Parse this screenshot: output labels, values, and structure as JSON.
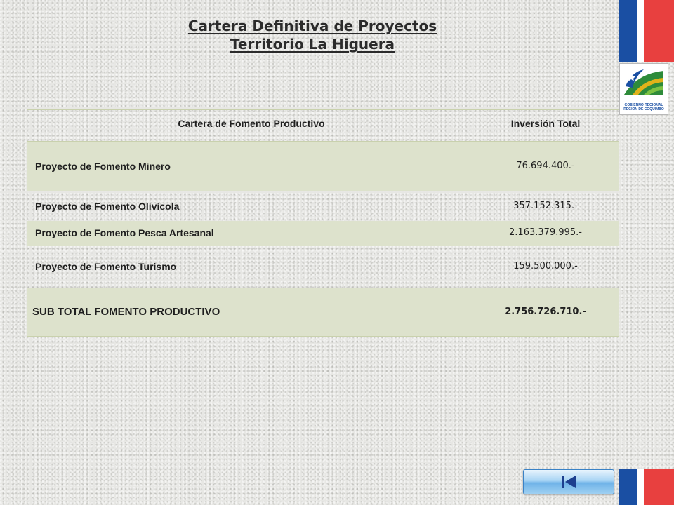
{
  "header": {
    "title_line1": "Cartera Definitiva de Proyectos",
    "title_line2": "Territorio La Higuera"
  },
  "logo": {
    "icon": "gobierno-regional-logo",
    "text_line1": "GOBIERNO REGIONAL",
    "text_line2": "REGION DE COQUIMBO"
  },
  "flag_colors": {
    "blue": "#1a4fa3",
    "white": "#ffffff",
    "red": "#e8403f"
  },
  "table": {
    "headers": [
      "Cartera de Fomento Productivo",
      "Inversión Total"
    ],
    "rows": [
      {
        "name": "Proyecto de Fomento Minero",
        "amount": "76.694.400.-"
      },
      {
        "name": "Proyecto de Fomento Olivícola",
        "amount": "357.152.315.-"
      },
      {
        "name": "Proyecto de Fomento Pesca Artesanal",
        "amount": "2.163.379.995.-"
      },
      {
        "name": "Proyecto de Fomento Turismo",
        "amount": "159.500.000.-"
      }
    ],
    "subtotal": {
      "name": "SUB TOTAL FOMENTO PRODUCTIVO",
      "amount": "2.756.726.710.-"
    }
  },
  "nav": {
    "icon": "skip-to-first-icon"
  }
}
